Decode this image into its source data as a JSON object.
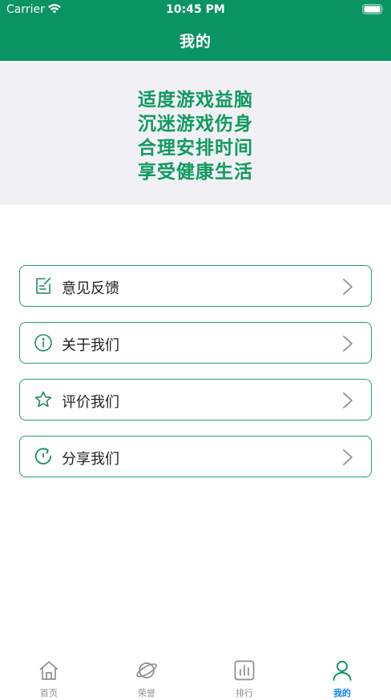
{
  "status_bar": {
    "carrier": "Carrier",
    "time": "10:45 PM"
  },
  "nav": {
    "title": "我的"
  },
  "banner": {
    "lines": [
      "适度游戏益脑",
      "沉迷游戏伤身",
      "合理安排时间",
      "享受健康生活"
    ],
    "color": "#119a5f"
  },
  "menu": {
    "items": [
      {
        "label": "意见反馈",
        "icon": "feedback-icon"
      },
      {
        "label": "关于我们",
        "icon": "info-icon"
      },
      {
        "label": "评价我们",
        "icon": "star-icon"
      },
      {
        "label": "分享我们",
        "icon": "share-icon"
      }
    ]
  },
  "tabbar": {
    "tabs": [
      {
        "label": "首页",
        "icon": "home-icon",
        "active": false
      },
      {
        "label": "荣誉",
        "icon": "planet-icon",
        "active": false
      },
      {
        "label": "排行",
        "icon": "bar-chart-icon",
        "active": false
      },
      {
        "label": "我的",
        "icon": "person-icon",
        "active": true
      }
    ]
  },
  "colors": {
    "brand": "#0a9463",
    "accent": "#1fa072",
    "tab_active": "#0a84ff",
    "tab_inactive": "#8e8e93"
  }
}
